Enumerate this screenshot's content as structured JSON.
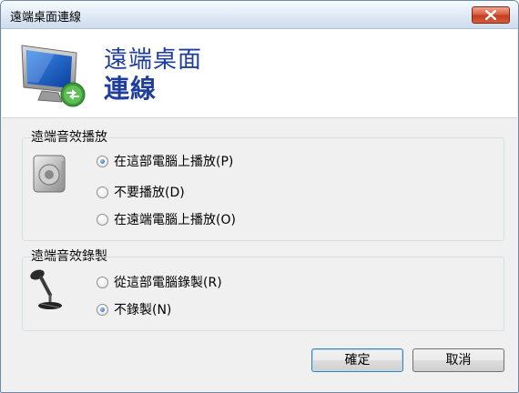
{
  "window": {
    "title": "遠端桌面連線"
  },
  "header": {
    "app_name_line1": "遠端桌面",
    "app_name_line2": "連線"
  },
  "playback": {
    "label": "遠端音效播放",
    "options": [
      {
        "label": "在這部電腦上播放(P)",
        "checked": true
      },
      {
        "label": "不要播放(D)",
        "checked": false
      },
      {
        "label": "在遠端電腦上播放(O)",
        "checked": false
      }
    ]
  },
  "recording": {
    "label": "遠端音效錄製",
    "options": [
      {
        "label": "從這部電腦錄製(R)",
        "checked": false
      },
      {
        "label": "不錄製(N)",
        "checked": true
      }
    ]
  },
  "buttons": {
    "ok": "確定",
    "cancel": "取消"
  },
  "colors": {
    "title_blue": "#1f3d9c",
    "close_red": "#c33b1d",
    "accent": "#3c7fb1"
  },
  "icons": [
    "close-icon",
    "remote-desktop-icon",
    "speaker-icon",
    "microphone-icon"
  ]
}
